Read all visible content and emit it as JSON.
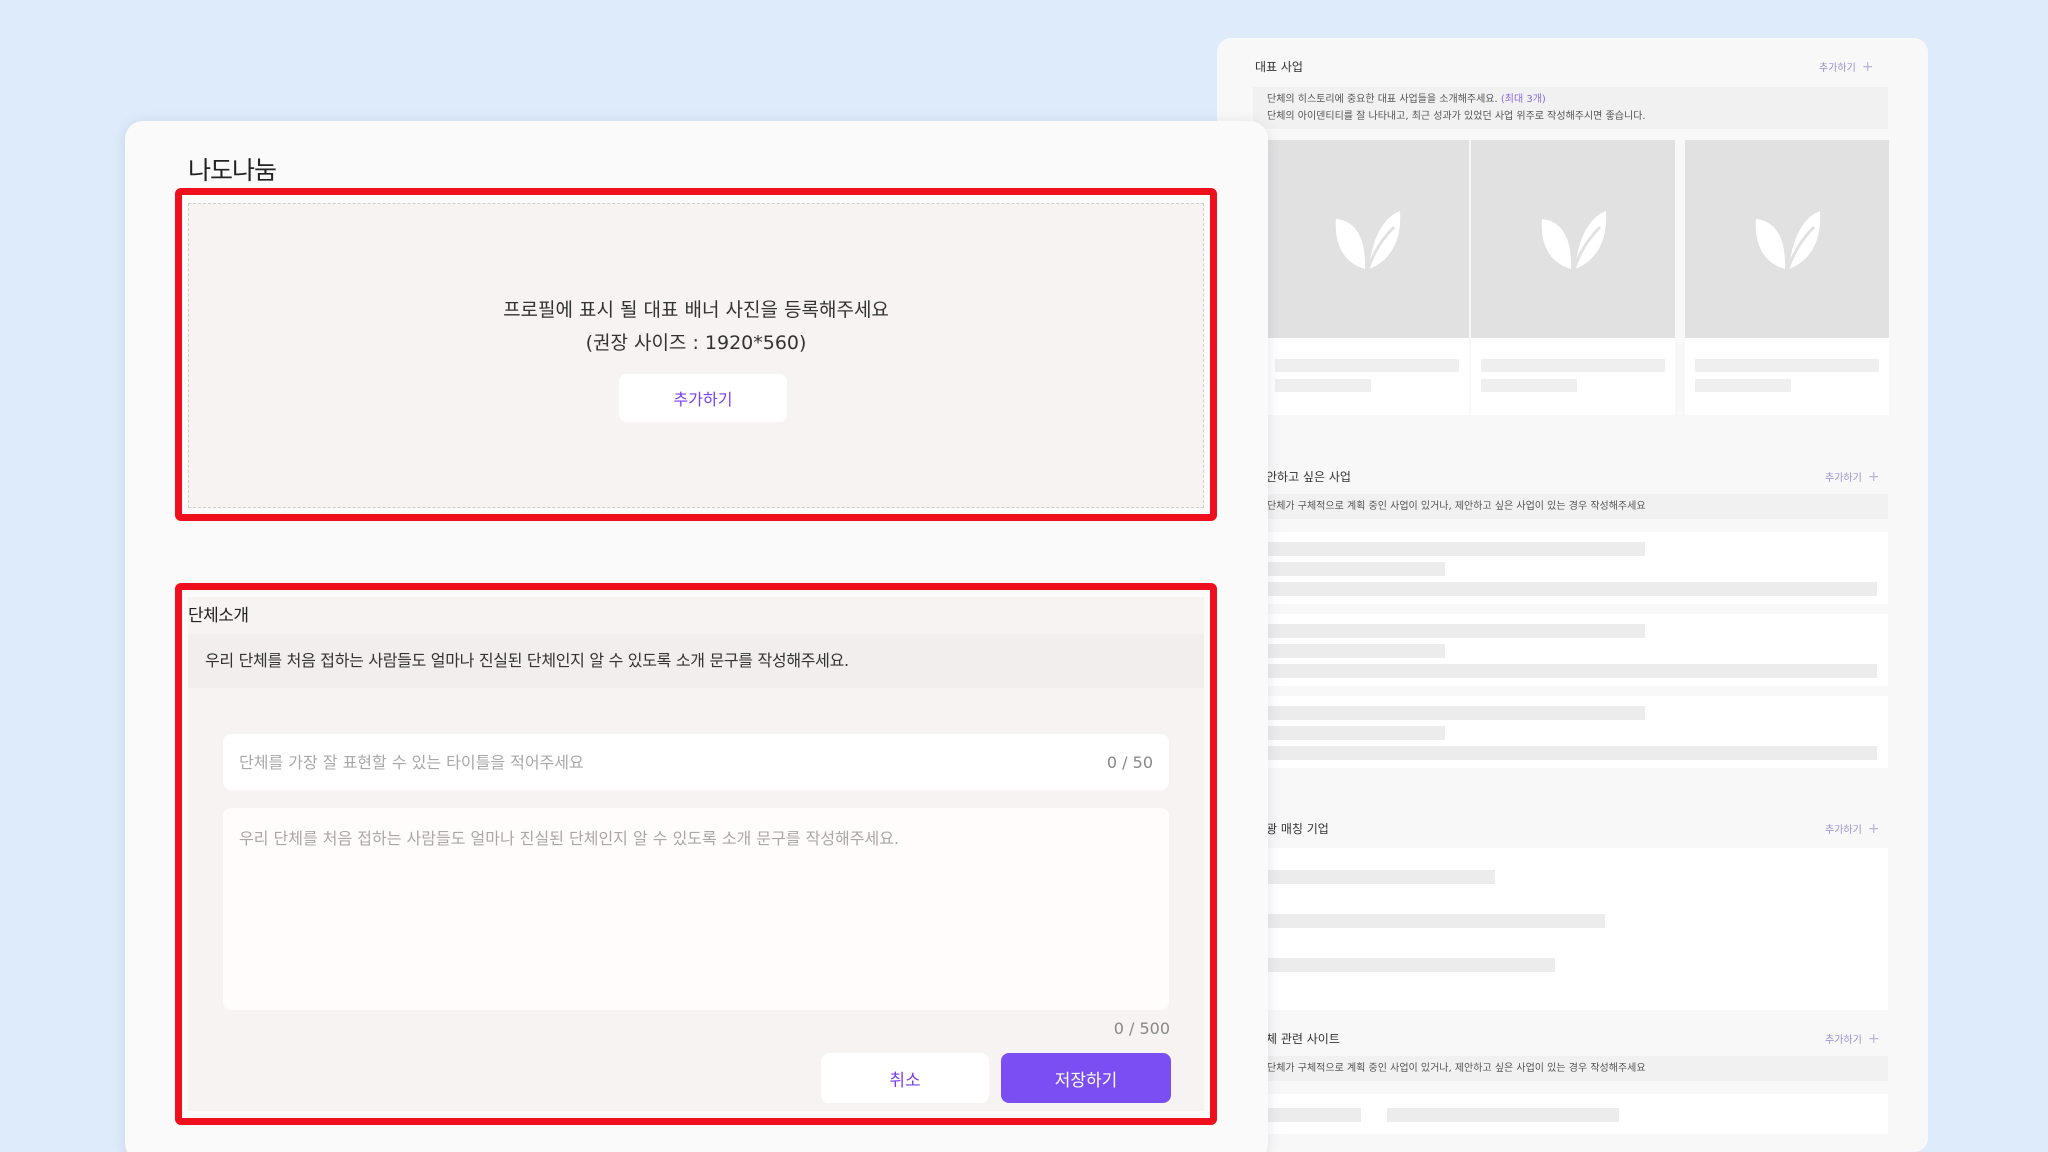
{
  "colors": {
    "accent": "#7a4ef2",
    "highlight": "#ef0f1d",
    "background": "#ddebfb"
  },
  "profile_panel": {
    "featured": {
      "title": "대표 사업",
      "add_label": "추가하기",
      "desc_line1": "단체의 히스토리에 중요한 대표 사업들을 소개해주세요.",
      "desc_max": "(최대 3개)",
      "desc_line2": "단체의 아이덴티티를 잘 나타내고, 최근 성과가 있었던 사업 위주로 작성해주시면 좋습니다."
    },
    "proposal": {
      "title": "안하고 싶은 사업",
      "add_label": "추가하기",
      "desc": "단체가 구체적으로 계획 중인 사업이 있거나, 제안하고 싶은 사업이 있는 경우 작성해주세요"
    },
    "matching": {
      "title": "광 매칭 기업",
      "add_label": "추가하기"
    },
    "sites": {
      "title": "체 관련 사이트",
      "add_label": "추가하기",
      "desc": "단체가 구체적으로 계획 중인 사업이 있거나, 제안하고 싶은 사업이 있는 경우 작성해주세요"
    }
  },
  "modal": {
    "title": "나도나눔",
    "banner": {
      "line1": "프로필에 표시 될 대표 배너 사진을 등록해주세요",
      "line2": "(권장 사이즈 : 1920*560)",
      "add_label": "추가하기"
    },
    "intro": {
      "title": "단체소개",
      "desc": "우리 단체를 처음 접하는 사람들도 얼마나 진실된 단체인지 알 수 있도록 소개 문구를 작성해주세요.",
      "title_placeholder": "단체를 가장 잘 표현할 수 있는 타이틀을 적어주세요",
      "title_counter": "0 / 50",
      "body_placeholder": "우리 단체를 처음 접하는 사람들도 얼마나 진실된 단체인지 알 수 있도록 소개 문구를 작성해주세요.",
      "body_counter": "0 / 500",
      "cancel_label": "취소",
      "save_label": "저장하기"
    }
  }
}
